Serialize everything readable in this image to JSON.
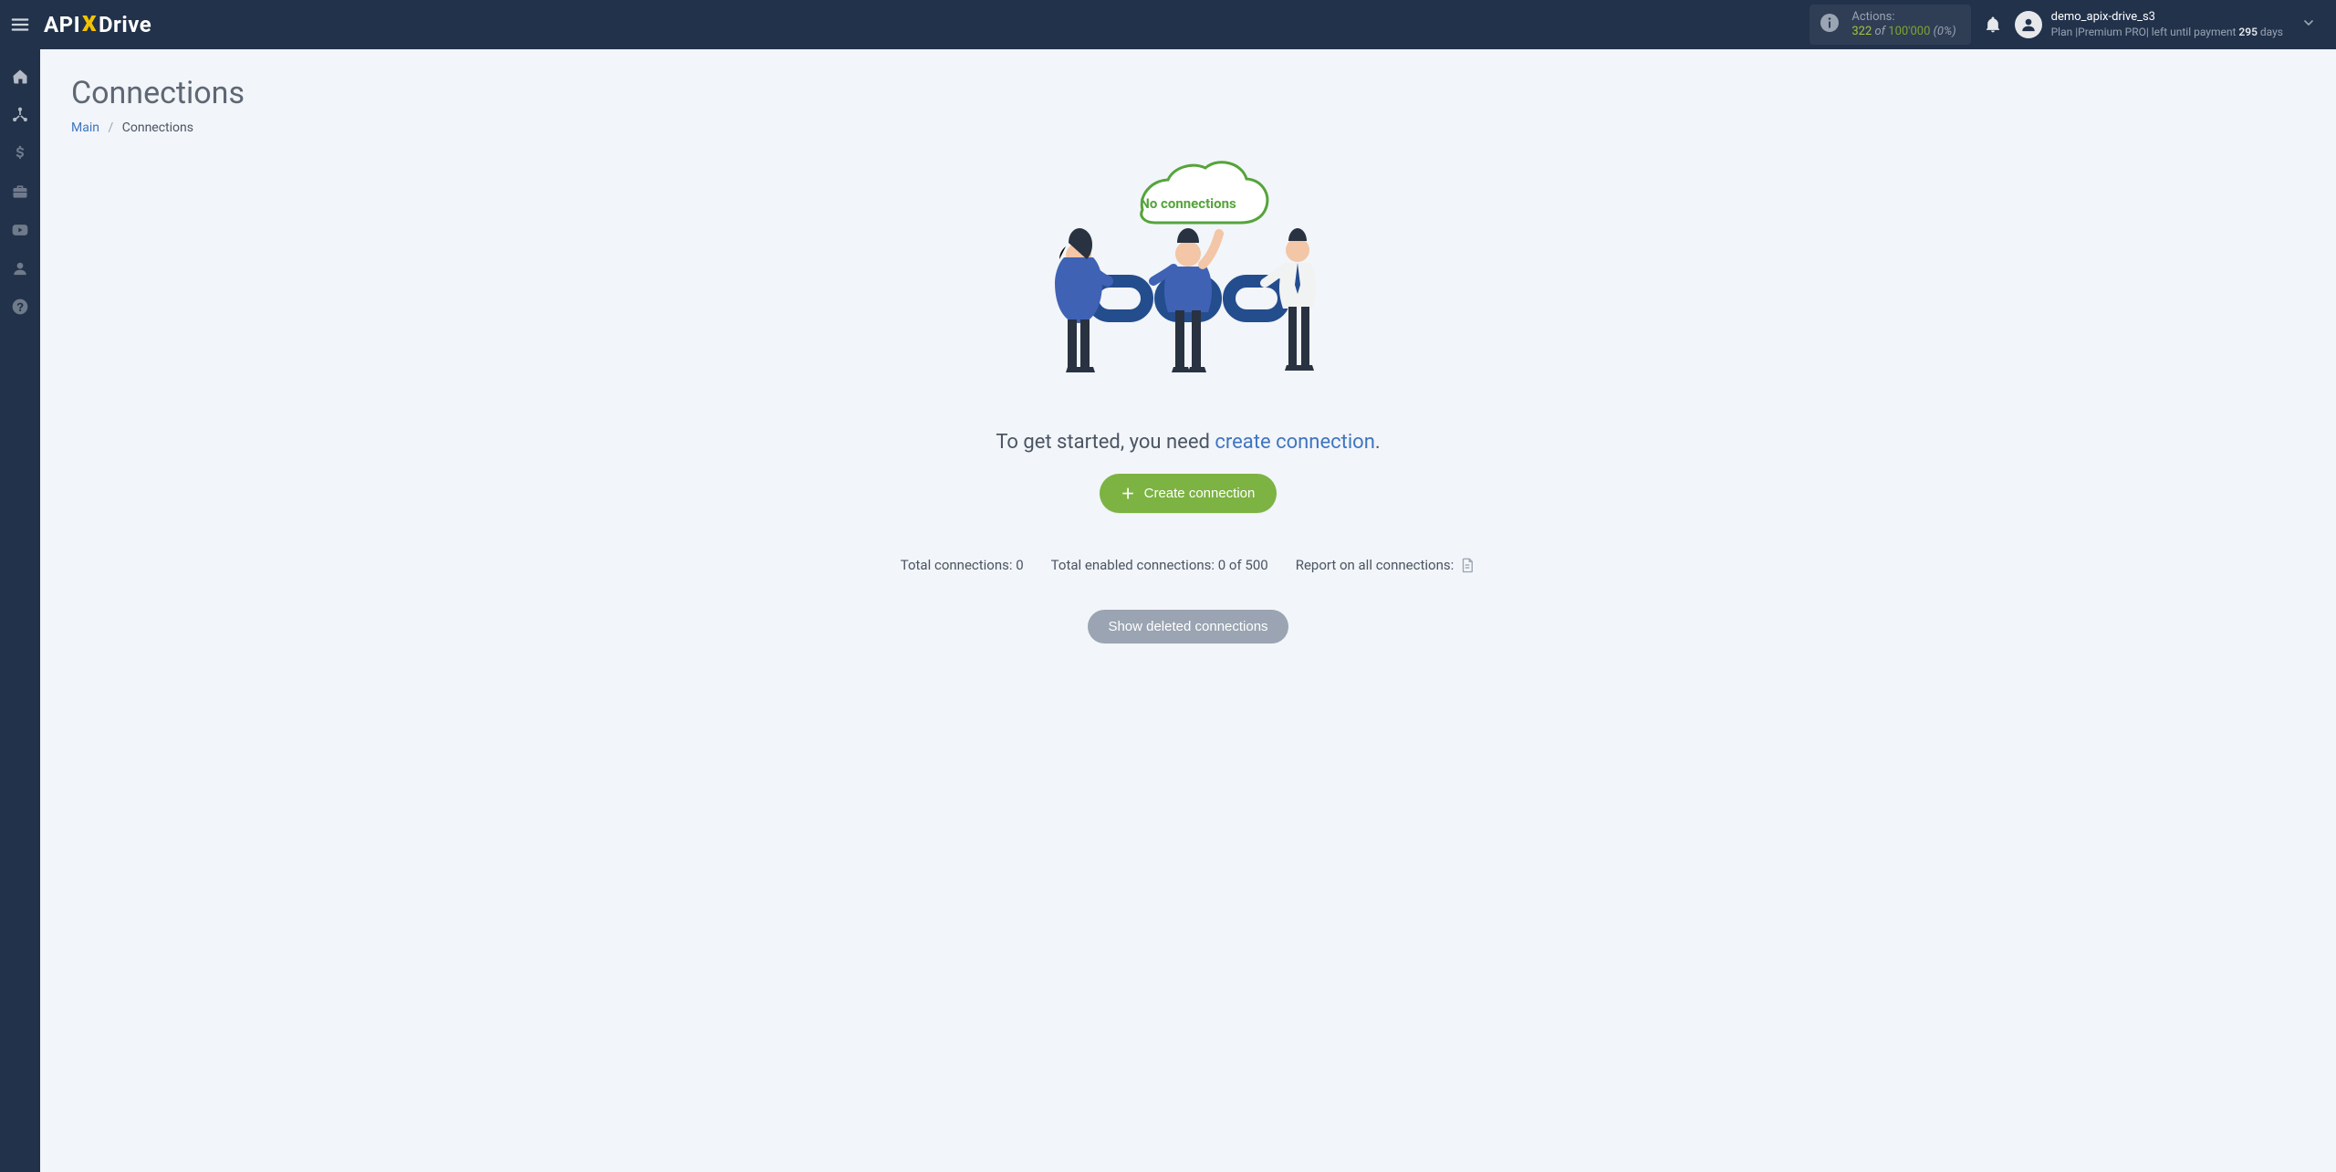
{
  "brand": {
    "prefix": "API",
    "x": "X",
    "suffix": "Drive"
  },
  "topbar": {
    "actions": {
      "label": "Actions:",
      "current": "322",
      "of": " of ",
      "max": "100'000",
      "percent": " (0%)"
    },
    "user": {
      "name": "demo_apix-drive_s3",
      "plan_prefix": "Plan |",
      "plan_name": "Premium PRO",
      "plan_sep": "| left until payment ",
      "days": "295",
      "plan_suffix": " days"
    }
  },
  "sidebar": {
    "items": [
      {
        "name": "home"
      },
      {
        "name": "connections"
      },
      {
        "name": "billing"
      },
      {
        "name": "briefcase"
      },
      {
        "name": "videos"
      },
      {
        "name": "account"
      },
      {
        "name": "help"
      }
    ]
  },
  "page": {
    "title": "Connections",
    "breadcrumb": {
      "main": "Main",
      "current": "Connections"
    },
    "empty": {
      "cloud_label": "No connections",
      "lead_text": "To get started, you need ",
      "lead_link": "create connection",
      "lead_tail": ".",
      "create_button": "Create connection"
    },
    "stats": {
      "total_label": "Total connections: ",
      "total_value": "0",
      "enabled_label": "Total enabled connections: ",
      "enabled_value": "0 of 500",
      "report_label": "Report on all connections:"
    },
    "show_deleted": "Show deleted connections"
  }
}
